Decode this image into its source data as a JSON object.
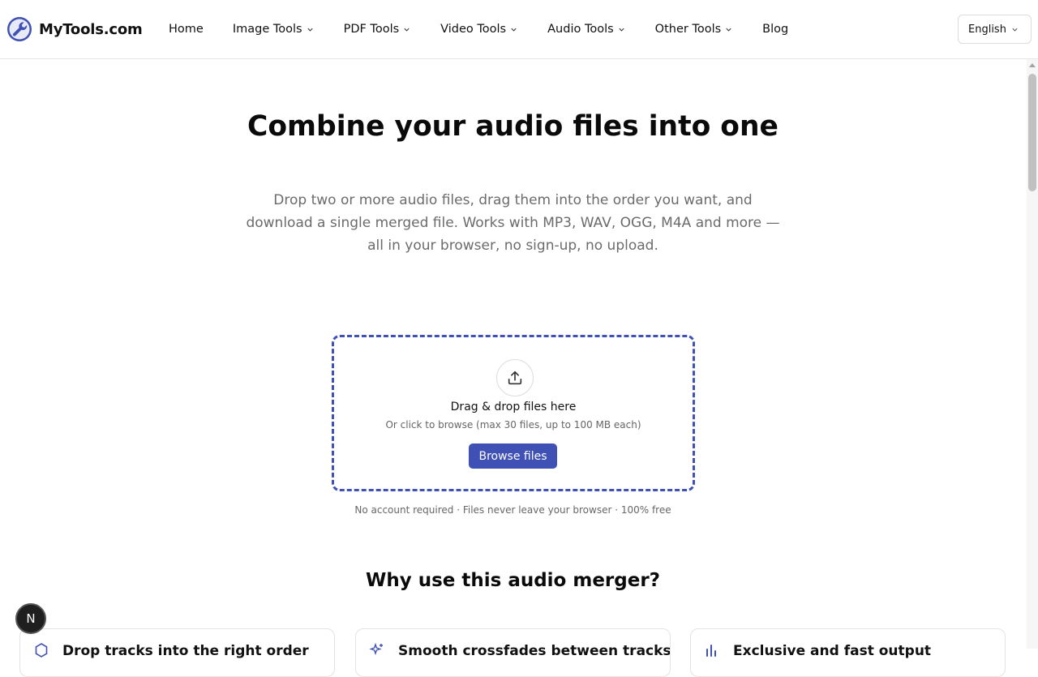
{
  "brand": {
    "name": "MyTools.com"
  },
  "nav": {
    "items": [
      {
        "label": "Home",
        "has_dropdown": false
      },
      {
        "label": "Image Tools",
        "has_dropdown": true
      },
      {
        "label": "PDF Tools",
        "has_dropdown": true
      },
      {
        "label": "Video Tools",
        "has_dropdown": true
      },
      {
        "label": "Audio Tools",
        "has_dropdown": true
      },
      {
        "label": "Other Tools",
        "has_dropdown": true
      },
      {
        "label": "Blog",
        "has_dropdown": false
      }
    ]
  },
  "language": {
    "selected": "English"
  },
  "hero": {
    "title": "Combine your audio files into one",
    "subtitle": "Drop two or more audio files, drag them into the order you want, and download a single merged file. Works with MP3, WAV, OGG, M4A and more — all in your browser, no sign-up, no upload."
  },
  "dropzone": {
    "icon": "upload-icon",
    "title": "Drag & drop files here",
    "hint": "Or click to browse (max 30 files, up to 100 MB each)",
    "button_label": "Browse files"
  },
  "trust_line": "No account required · Files never leave your browser · 100% free",
  "why": {
    "title": "Why use this audio merger?",
    "cards": [
      {
        "icon": "hexagon-icon",
        "title": "Drop tracks into the right order"
      },
      {
        "icon": "sparkle-icon",
        "title": "Smooth crossfades between tracks"
      },
      {
        "icon": "chart-icon",
        "title": "Exclusive and fast output"
      }
    ]
  },
  "floating_badge": {
    "label": "N"
  },
  "colors": {
    "accent": "#3f51b5",
    "text": "#111111",
    "muted": "#6b6b6b",
    "border": "#e5e5e5"
  }
}
